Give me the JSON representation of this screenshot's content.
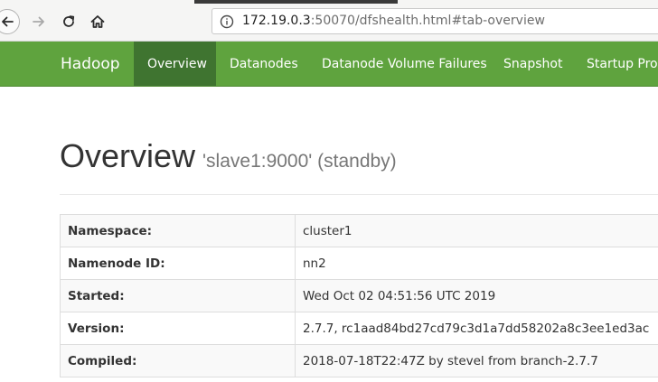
{
  "browser": {
    "url_host": "172.19.0.3",
    "url_rest": ":50070/dfshealth.html#tab-overview",
    "icons": [
      "back-arrow-icon",
      "forward-arrow-icon",
      "reload-icon",
      "home-icon",
      "info-icon"
    ]
  },
  "navbar": {
    "brand": "Hadoop",
    "items": [
      {
        "label": "Overview",
        "active": true
      },
      {
        "label": "Datanodes",
        "active": false
      },
      {
        "label": "Datanode Volume Failures",
        "active": false
      },
      {
        "label": "Snapshot",
        "active": false
      },
      {
        "label": "Startup Progress",
        "active": false
      }
    ],
    "colors": {
      "background": "#5fa33e",
      "active": "#3f7430",
      "text": "#ffffff"
    }
  },
  "header": {
    "title": "Overview",
    "subtitle": "'slave1:9000' (standby)"
  },
  "overview_table": {
    "rows": [
      {
        "label": "Namespace:",
        "value": "cluster1"
      },
      {
        "label": "Namenode ID:",
        "value": "nn2"
      },
      {
        "label": "Started:",
        "value": "Wed Oct 02 04:51:56 UTC 2019"
      },
      {
        "label": "Version:",
        "value": "2.7.7, rc1aad84bd27cd79c3d1a7dd58202a8c3ee1ed3ac"
      },
      {
        "label": "Compiled:",
        "value": "2018-07-18T22:47Z by stevel from branch-2.7.7"
      }
    ]
  }
}
